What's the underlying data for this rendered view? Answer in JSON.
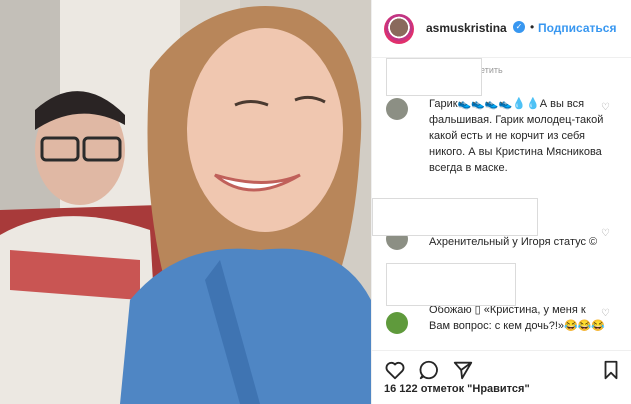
{
  "post": {
    "username": "asmuskristina",
    "verified_glyph": "✓",
    "separator": "•",
    "follow_label": "Подписаться",
    "likes_text": "16 122 отметок \"Нравится\""
  },
  "comments": [
    {
      "meta": "етить",
      "text": "Гарик👟👟👟👟💧💧А вы вся фальшивая. Гарик молодец-такой какой есть и не корчит из себя никого. А вы Кристина Мясникова всегда в маске."
    },
    {
      "meta": "",
      "text": "Ахренительный у Игоря статус ©"
    },
    {
      "meta": "",
      "text": "Обожаю ▯ «Кристина, у меня к Вам вопрос: с кем дочь?!»😂😂😂"
    }
  ],
  "icons": {
    "heart": "heart-icon",
    "comment": "comment-icon",
    "share": "share-icon",
    "bookmark": "bookmark-icon"
  }
}
